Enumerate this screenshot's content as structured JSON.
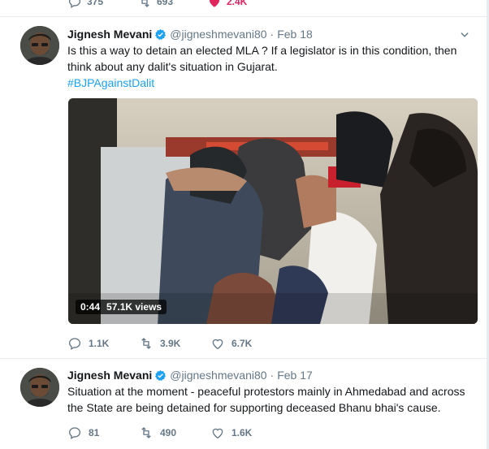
{
  "top_partial": {
    "reply_count": "375",
    "retweet_count": "693",
    "like_count": "2.4K",
    "like_color": "#e0245e"
  },
  "tweets": [
    {
      "name": "Jignesh Mevani",
      "handle": "@jigneshmevani80",
      "separator": "·",
      "date": "Feb 18",
      "text": "Is this a way to detain an elected MLA ? If a legislator is in this condition, then think about any dalit's situation in Gujarat.",
      "hashtag": "#BJPAgainstDalit",
      "video": {
        "duration": "0:44",
        "views": "57.1K views"
      },
      "reply_count": "1.1K",
      "retweet_count": "3.9K",
      "like_count": "6.7K"
    },
    {
      "name": "Jignesh Mevani",
      "handle": "@jigneshmevani80",
      "separator": "·",
      "date": "Feb 17",
      "text": "Situation at the moment - peaceful protestors mainly in Ahmedabad and across the State are being detained for supporting deceased Bhanu bhai's cause.",
      "reply_count": "81",
      "retweet_count": "490",
      "like_count": "1.6K"
    }
  ],
  "colors": {
    "verified": "#1da1f2",
    "link": "#1da1f2",
    "muted": "#657786",
    "divider": "#e6ecf0"
  },
  "icons": [
    "reply-icon",
    "retweet-icon",
    "like-icon",
    "verified-icon",
    "chevron-down-icon"
  ]
}
